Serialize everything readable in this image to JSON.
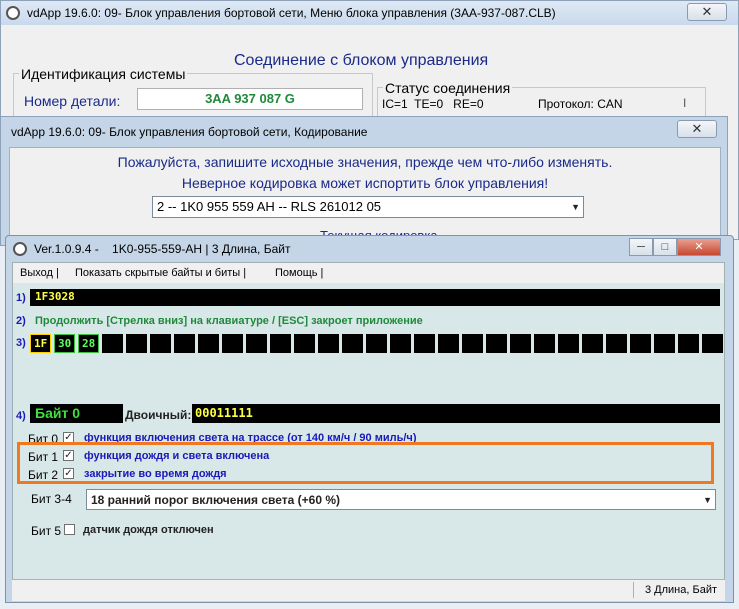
{
  "back_window": {
    "title": "vdApp 19.6.0: 09- Блок управления бортовой сети,  Меню блока управления (3AA-937-087.CLB)",
    "close": "✕",
    "heading": "Соединение с блоком управления",
    "ident_group": "Идентификация системы",
    "part_label": "Номер детали:",
    "part_value": "3AA 937 087 G",
    "status_group": "Статус соединения",
    "status_text": "IC=1  TE=0   RE=0",
    "protocol": "Протокол: CAN",
    "cursor": "I"
  },
  "middle_window": {
    "title": "vdApp 19.6.0: 09- Блок управления бортовой сети,  Кодирование",
    "close": "✕",
    "message1": "Пожалуйста, запишите исходные значения, прежде чем что-либо изменять.",
    "message2": "Неверное кодировка может испортить блок управления!",
    "dropdown_value": "2 -- 1K0 955 559 AH -- RLS 261012 05",
    "hidden_label": "Текущая кодировка"
  },
  "front_window": {
    "title": "Ver.1.0.9.4 -    1K0-955-559-AH | 3 Длина, Байт",
    "minimize": "─",
    "maximize": "□",
    "close": "✕",
    "menu": [
      "Выход |",
      "Показать скрытые байты и биты |",
      "Помощь |"
    ],
    "row1_num": "1)",
    "row1_value": "1F3028",
    "row2_num": "2)",
    "row2_text": "Продолжить [Стрелка вниз] на клавиатуре / [ESC] закроет приложение",
    "row3_num": "3)",
    "bytes": [
      "1F",
      "30",
      "28"
    ],
    "row4_num": "4)",
    "byte_label": "Байт 0",
    "binary_label": "Двоичный:",
    "binary_value": "00011111",
    "bits": [
      {
        "label": "Бит 0",
        "checked": true,
        "text": "функция включения света на трассе (от 140 км/ч / 90 миль/ч)"
      },
      {
        "label": "Бит 1",
        "checked": true,
        "text": "функция дождя и света включена"
      },
      {
        "label": "Бит 2",
        "checked": true,
        "text": "закрытие во время дождя"
      }
    ],
    "bit34_label": "Бит 3-4",
    "bit34_value": "18 ранний порог включения света (+60 %)",
    "bit5_label": "Бит 5",
    "bit5_checked": false,
    "bit5_text": "датчик дождя отключен",
    "status_text": "3 Длина, Байт",
    "highlight_color": "#f07820"
  }
}
